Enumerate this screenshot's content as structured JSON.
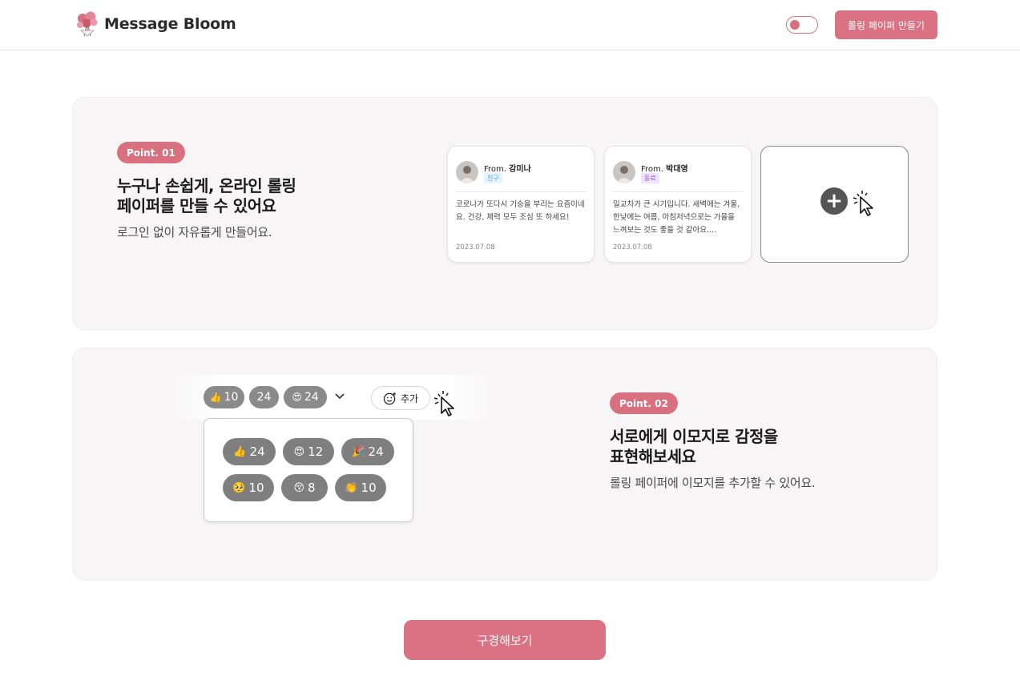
{
  "header": {
    "brand": "Message Bloom",
    "create_button": "롤링 페이퍼 만들기"
  },
  "point1": {
    "badge": "Point. 01",
    "title_line1": "누구나 손쉽게, 온라인 롤링",
    "title_line2": "페이퍼를 만들 수 있어요",
    "subtitle": "로그인 없이 자유롭게 만들어요.",
    "cards": [
      {
        "from_prefix": "From.",
        "name": "강미나",
        "relation": "친구",
        "content": "코로나가 또다시 기승을 부리는 요즘이네요. 건강, 체력 모두 조심 또 하세요!",
        "date": "2023.07.08"
      },
      {
        "from_prefix": "From.",
        "name": "박대영",
        "relation": "동료",
        "content": "일교차가 큰 시기입니다. 새벽에는 겨울, 한낮에는 여름, 아침저녁으로는 가을을 느껴보는 것도 좋을 것 같아요....",
        "date": "2023.07.08"
      }
    ],
    "plus": "+"
  },
  "point2": {
    "badge": "Point. 02",
    "title_line1": "서로에게 이모지로 감정을",
    "title_line2": "표현해보세요",
    "subtitle": "롤링 페이퍼에 이모지를 추가할 수 있어요.",
    "top_reactions": [
      {
        "emoji": "👍",
        "count": "10"
      },
      {
        "emoji": "",
        "count": "24"
      },
      {
        "emoji": "😍",
        "count": "24"
      }
    ],
    "add_label": "추가",
    "popup_reactions": [
      {
        "emoji": "👍",
        "count": "24"
      },
      {
        "emoji": "😍",
        "count": "12"
      },
      {
        "emoji": "🎉",
        "count": "24"
      },
      {
        "emoji": "🥺",
        "count": "10"
      },
      {
        "emoji": "😚",
        "count": "8"
      },
      {
        "emoji": "👏",
        "count": "10"
      }
    ]
  },
  "cta": "구경해보기",
  "colors": {
    "accent": "#db7283",
    "panel_bg": "#f7f5f6",
    "pill": "#8a8a8a"
  }
}
